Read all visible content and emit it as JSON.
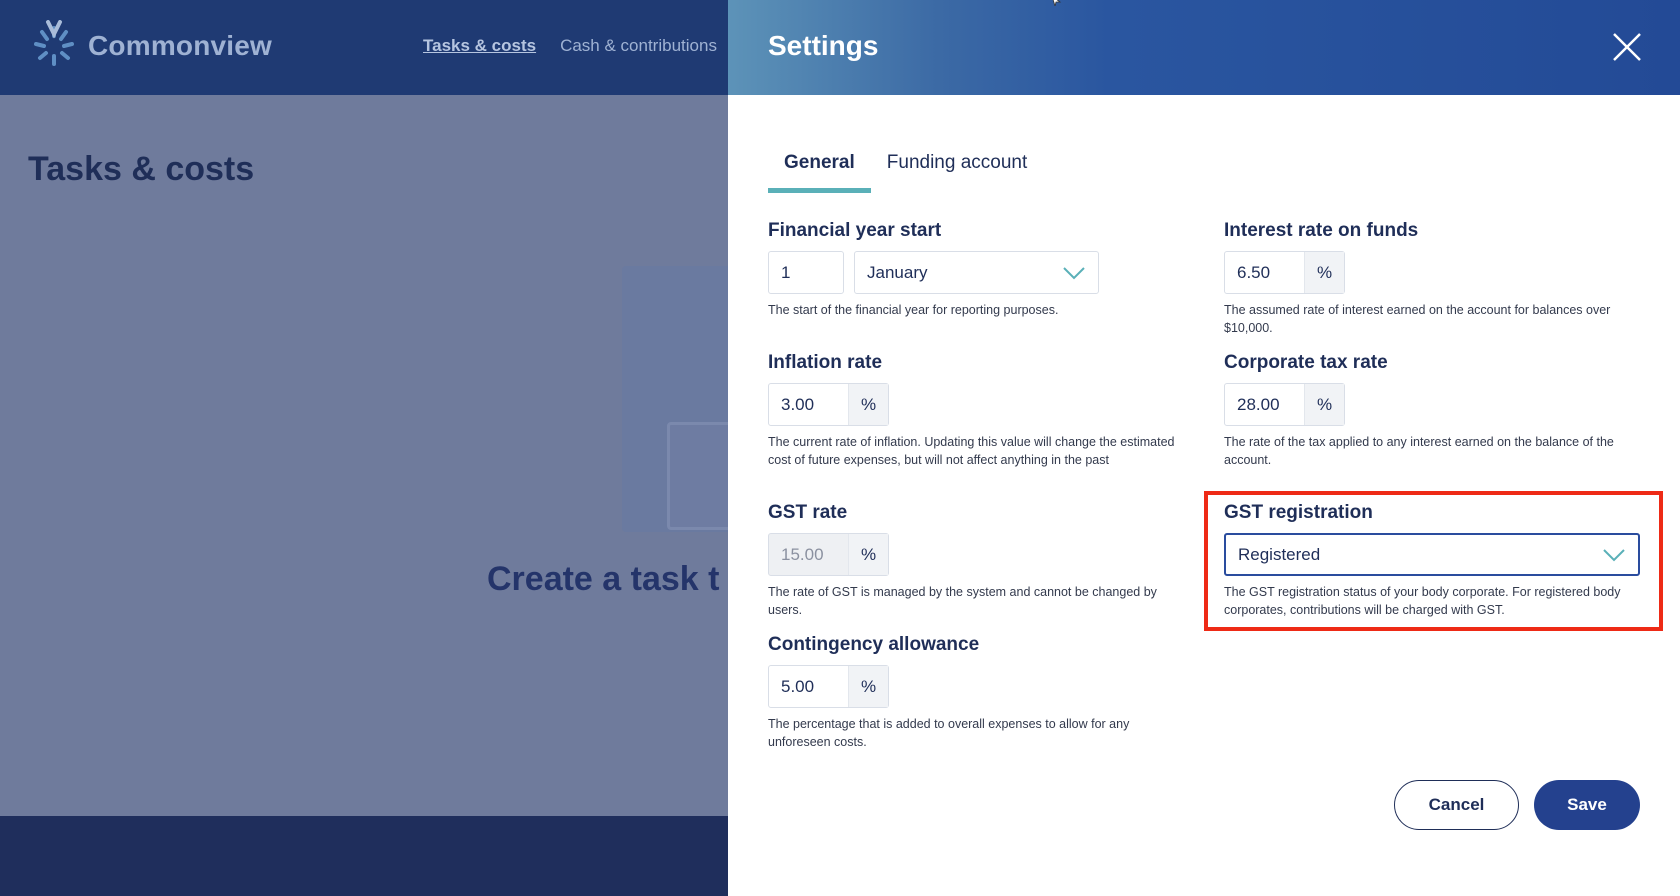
{
  "app": {
    "logo_text": "Commonview",
    "nav": [
      "Tasks & costs",
      "Cash & contributions"
    ],
    "page_title": "Tasks & costs",
    "empty_state": "Create a task t"
  },
  "settings": {
    "title": "Settings",
    "tabs": [
      {
        "label": "General",
        "active": true
      },
      {
        "label": "Funding account",
        "active": false
      }
    ],
    "fields": {
      "financial_year_start": {
        "label": "Financial year start",
        "day": "1",
        "month": "January",
        "help": "The start of the financial year for reporting purposes."
      },
      "interest_rate": {
        "label": "Interest rate on funds",
        "value": "6.50",
        "suffix": "%",
        "help": "The assumed rate of interest earned on the account for balances over $10,000."
      },
      "inflation_rate": {
        "label": "Inflation rate",
        "value": "3.00",
        "suffix": "%",
        "help": "The current rate of inflation. Updating this value will change the estimated cost of future expenses, but will not affect anything in the past"
      },
      "corporate_tax_rate": {
        "label": "Corporate tax rate",
        "value": "28.00",
        "suffix": "%",
        "help": "The rate of the tax applied to any interest earned on the balance of the account."
      },
      "gst_rate": {
        "label": "GST rate",
        "value": "15.00",
        "suffix": "%",
        "help": "The rate of GST is managed by the system and cannot be changed by users."
      },
      "gst_registration": {
        "label": "GST registration",
        "value": "Registered",
        "help": "The GST registration status of your body corporate. For registered body corporates, contributions will be charged with GST."
      },
      "contingency": {
        "label": "Contingency allowance",
        "value": "5.00",
        "suffix": "%",
        "help": "The percentage that is added to overall expenses to allow for any unforeseen costs."
      }
    },
    "buttons": {
      "cancel": "Cancel",
      "save": "Save"
    }
  },
  "colors": {
    "header": "#1f3a73",
    "primary": "#24418e",
    "tab_accent": "#5ab0b8",
    "highlight": "#ee2a16"
  }
}
